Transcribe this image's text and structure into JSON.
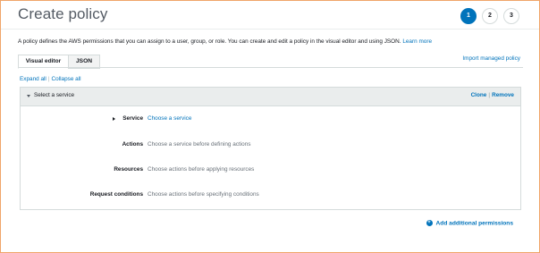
{
  "header": {
    "title": "Create policy",
    "steps": [
      "1",
      "2",
      "3"
    ],
    "active_step": "1"
  },
  "description": {
    "text": "A policy defines the AWS permissions that you can assign to a user, group, or role. You can create and edit a policy in the visual editor and using JSON.",
    "link": "Learn more"
  },
  "tabs": [
    {
      "label": "Visual editor",
      "active": true
    },
    {
      "label": "JSON",
      "active": false
    }
  ],
  "import_link": "Import managed policy",
  "expand_all": "Expand all",
  "collapse_all": "Collapse all",
  "panel": {
    "header_label": "Select a service",
    "clone": "Clone",
    "remove": "Remove",
    "rows": [
      {
        "label": "Service",
        "value": "Choose a service"
      },
      {
        "label": "Actions",
        "value": "Choose a service before defining actions"
      },
      {
        "label": "Resources",
        "value": "Choose actions before applying resources"
      },
      {
        "label": "Request conditions",
        "value": "Choose actions before specifying conditions"
      }
    ]
  },
  "add_permissions": "Add additional permissions",
  "colors": {
    "accent": "#0073bb",
    "frame_border": "#f0a56a",
    "panel_header": "#eaeded",
    "muted_text": "#687078"
  },
  "icons": {
    "panel_toggle": "caret-down-icon",
    "service_expand": "caret-right-icon",
    "add": "plus-circle-icon"
  }
}
